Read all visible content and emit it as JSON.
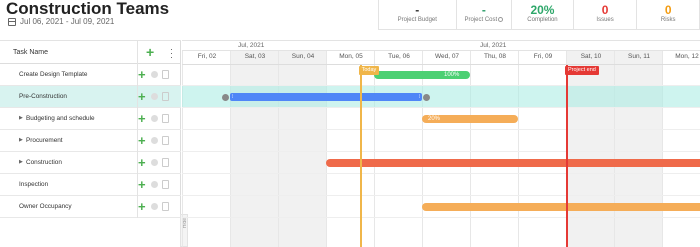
{
  "project": {
    "title": "Construction Teams",
    "date_range": "Jul 06, 2021 - Jul 09, 2021"
  },
  "stats": [
    {
      "value": "-",
      "label": "Project Budget",
      "color": "#333333"
    },
    {
      "value": "-",
      "label": "Project Cost",
      "color": "#2e9e6b"
    },
    {
      "value": "20%",
      "label": "Completion",
      "color": "#2ea76a"
    },
    {
      "value": "0",
      "label": "Issues",
      "color": "#e53935"
    },
    {
      "value": "0",
      "label": "Risks",
      "color": "#f39c12"
    }
  ],
  "table": {
    "header": "Task Name",
    "hide_label": "Hide",
    "tasks": [
      {
        "name": "Create Design Template",
        "indent": 0,
        "expandable": false
      },
      {
        "name": "Pre-Construction",
        "indent": 0,
        "expandable": false,
        "selected": true
      },
      {
        "name": "Budgeting and schedule",
        "indent": 1,
        "expandable": true
      },
      {
        "name": "Procurement",
        "indent": 1,
        "expandable": true
      },
      {
        "name": "Construction",
        "indent": 1,
        "expandable": true
      },
      {
        "name": "Inspection",
        "indent": 0,
        "expandable": false
      },
      {
        "name": "Owner Occupancy",
        "indent": 0,
        "expandable": false
      }
    ]
  },
  "timeline": {
    "months": [
      "Jul, 2021",
      "Jul, 2021"
    ],
    "days": [
      {
        "label": "Fri, 02",
        "weekend": false
      },
      {
        "label": "Sat, 03",
        "weekend": true
      },
      {
        "label": "Sun, 04",
        "weekend": true
      },
      {
        "label": "Mon, 05",
        "weekend": false
      },
      {
        "label": "Tue, 06",
        "weekend": false
      },
      {
        "label": "Wed, 07",
        "weekend": false
      },
      {
        "label": "Thu, 08",
        "weekend": false
      },
      {
        "label": "Fri, 09",
        "weekend": false
      },
      {
        "label": "Sat, 10",
        "weekend": true
      },
      {
        "label": "Sun, 11",
        "weekend": true
      },
      {
        "label": "Mon, 12",
        "weekend": false
      }
    ],
    "today_label": "Today",
    "project_end_label": "Project end",
    "bars": [
      {
        "row": 0,
        "start": 4.0,
        "end": 6.0,
        "color": "#4cd073",
        "label": "100%"
      },
      {
        "row": 1,
        "start": 1.0,
        "end": 5.0,
        "color": "#4f86f7",
        "label": ""
      },
      {
        "row": 2,
        "start": 5.0,
        "end": 7.0,
        "color": "#f5ad58",
        "label": "20%"
      },
      {
        "row": 4,
        "start": 3.0,
        "end": 11.0,
        "color": "#ef6a4a",
        "label": ""
      },
      {
        "row": 6,
        "start": 5.0,
        "end": 11.0,
        "color": "#f5ad58",
        "label": ""
      }
    ]
  }
}
